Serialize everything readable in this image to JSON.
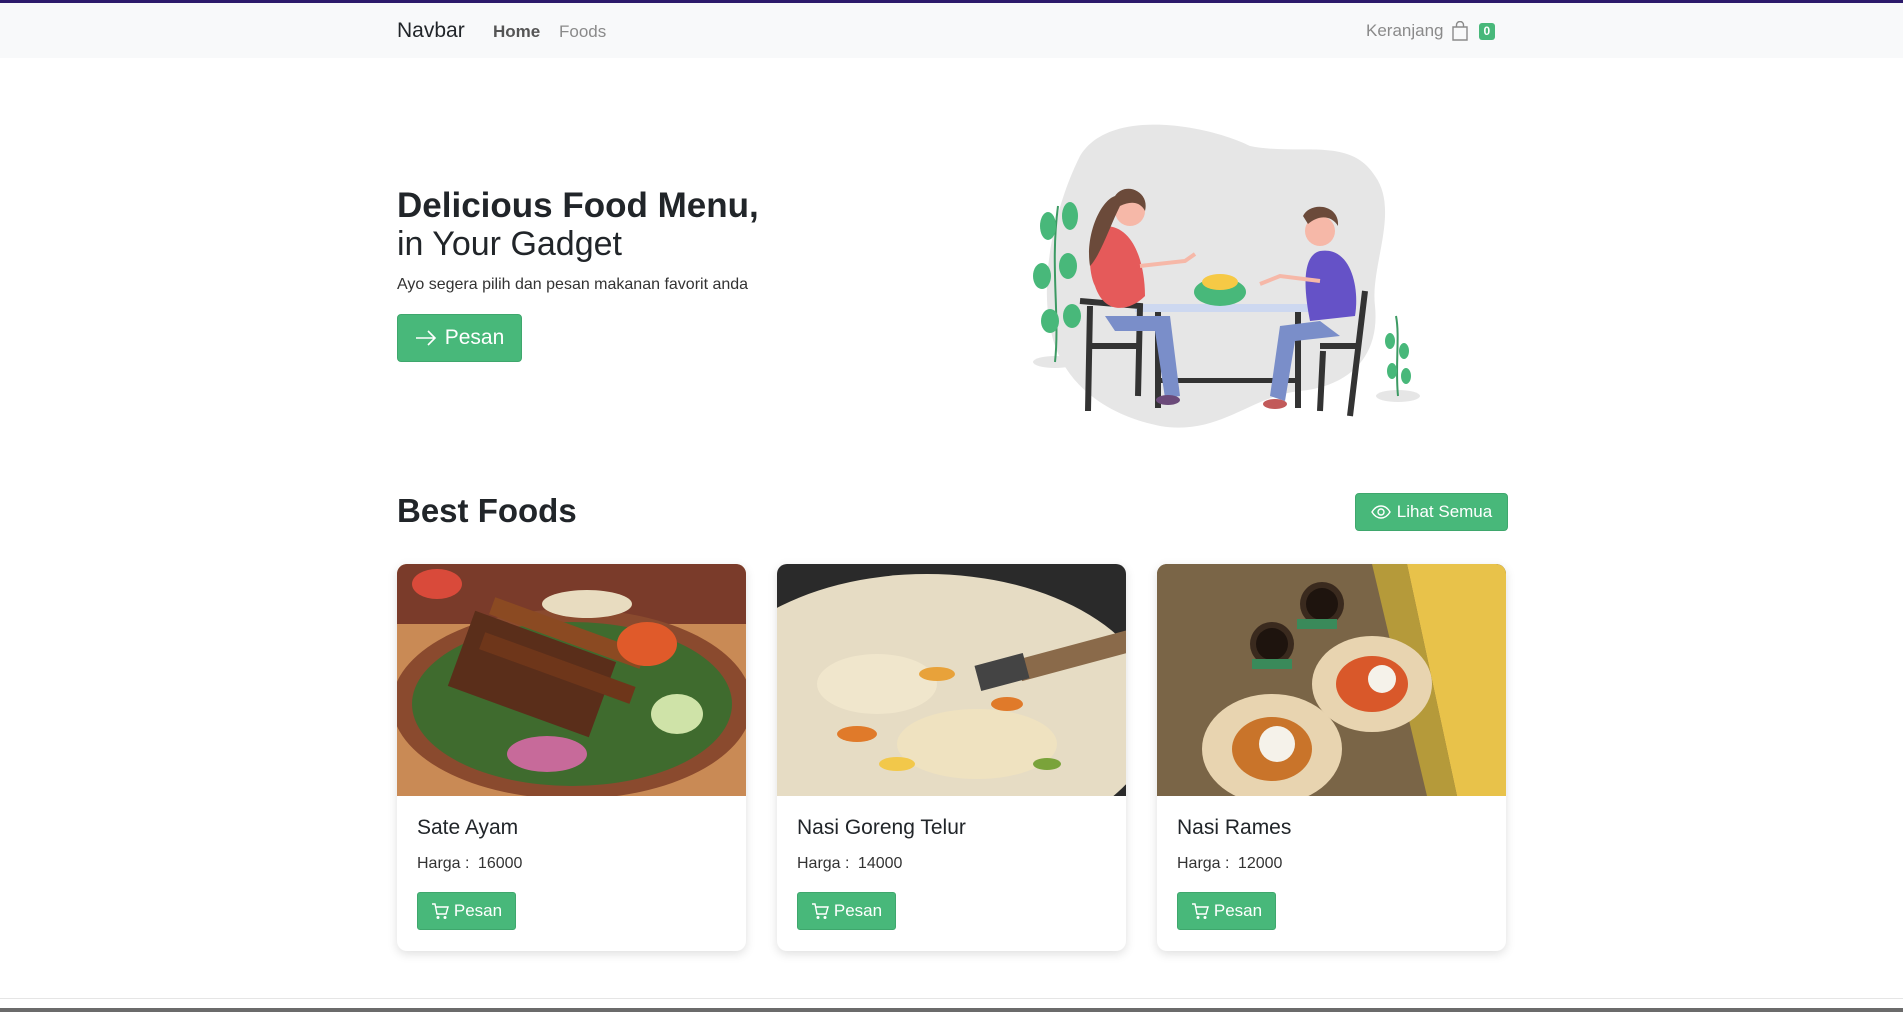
{
  "navbar": {
    "brand": "Navbar",
    "links": [
      {
        "label": "Home",
        "active": true
      },
      {
        "label": "Foods",
        "active": false
      }
    ],
    "cart": {
      "label": "Keranjang",
      "count": "0",
      "icon": "bag-icon"
    }
  },
  "hero": {
    "title": "Delicious Food Menu,",
    "subtitle": "in Your Gadget",
    "description": "Ayo segera pilih dan pesan makanan favorit anda",
    "button_label": "Pesan",
    "button_icon": "arrow-right-icon"
  },
  "best_foods": {
    "title_light": "Best",
    "title_bold": "Foods",
    "see_all_label": "Lihat Semua",
    "see_all_icon": "eye-icon",
    "items": [
      {
        "name": "Sate Ayam",
        "price_label": "Harga :",
        "price": "16000",
        "button_label": "Pesan"
      },
      {
        "name": "Nasi Goreng Telur",
        "price_label": "Harga :",
        "price": "14000",
        "button_label": "Pesan"
      },
      {
        "name": "Nasi Rames",
        "price_label": "Harga :",
        "price": "12000",
        "button_label": "Pesan"
      }
    ]
  },
  "colors": {
    "accent": "#48b87a",
    "navbar_bg": "#f8f9fa",
    "text": "#212529"
  }
}
